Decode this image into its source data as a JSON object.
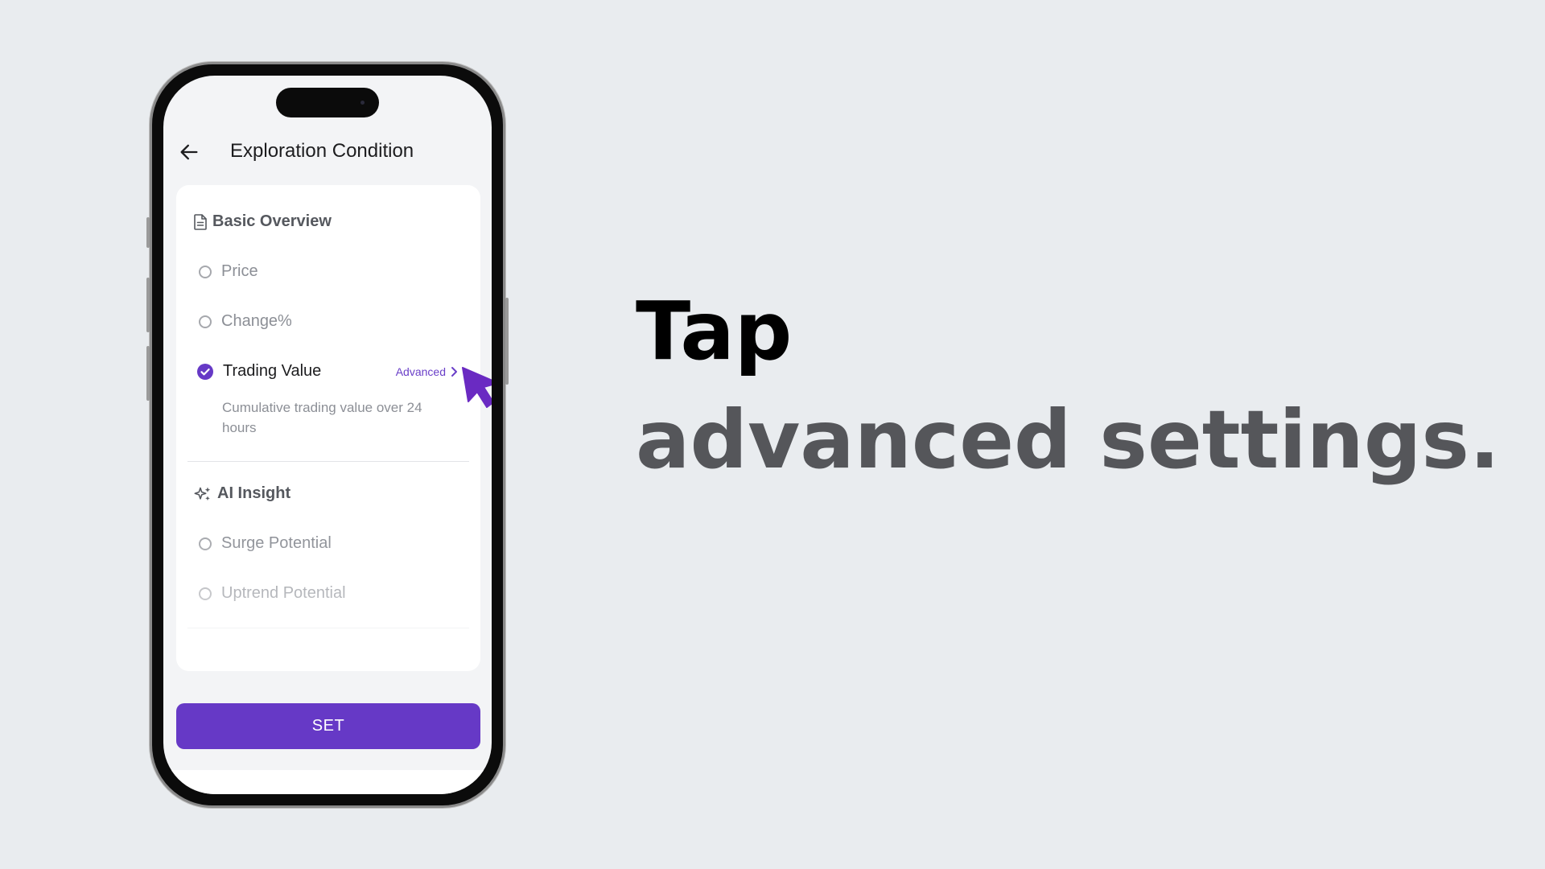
{
  "header": {
    "title": "Exploration Condition",
    "back_icon": "arrow-left-icon"
  },
  "sections": [
    {
      "title": "Basic Overview",
      "icon": "document-icon",
      "options": [
        {
          "label": "Price",
          "selected": false
        },
        {
          "label": "Change%",
          "selected": false
        },
        {
          "label": "Trading Value",
          "selected": true,
          "link_label": "Advanced",
          "description": "Cumulative trading value over 24 hours"
        }
      ]
    },
    {
      "title": "AI Insight",
      "icon": "sparkle-icon",
      "options": [
        {
          "label": "Surge Potential",
          "selected": false
        },
        {
          "label": "Uptrend Potential",
          "selected": false
        }
      ]
    }
  ],
  "set_button": {
    "label": "SET"
  },
  "caption": {
    "line1": "Tap",
    "line2": "advanced settings."
  },
  "colors": {
    "accent": "#6639c6",
    "link": "#6a3fc8",
    "cursor": "#6a2ac2",
    "background": "#e9ecef"
  },
  "cursor_icon": "pointer-cursor-icon"
}
